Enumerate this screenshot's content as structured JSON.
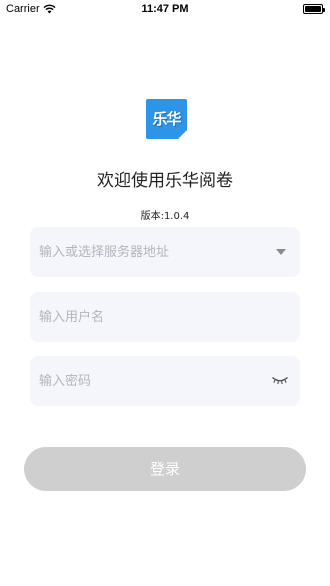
{
  "status_bar": {
    "carrier": "Carrier",
    "time": "11:47 PM"
  },
  "logo": {
    "text": "乐华",
    "color": "#2e94e8"
  },
  "welcome": "欢迎使用乐华阅卷",
  "version": "版本:1.0.4",
  "form": {
    "server": {
      "placeholder": "输入或选择服务器地址",
      "value": "",
      "icon": "dropdown-arrow-icon"
    },
    "username": {
      "placeholder": "输入用户名",
      "value": ""
    },
    "password": {
      "placeholder": "输入密码",
      "value": "",
      "icon": "eye-closed-icon"
    }
  },
  "login_button": {
    "label": "登录",
    "color": "#cfcfcf"
  }
}
